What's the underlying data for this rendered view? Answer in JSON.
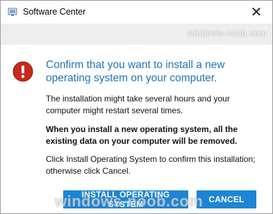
{
  "window": {
    "title": "Software Center",
    "close_glyph": "✕",
    "app_icon": "software-center-icon"
  },
  "watermark": {
    "top": "windows-noob.com",
    "bottom": "windows-noob.com"
  },
  "dialog": {
    "icon": "error-icon",
    "heading": "Confirm that you want to install a new operating system on your computer.",
    "paragraph1": "The installation might take several hours and your computer might restart several times.",
    "paragraph2": "When you install a new operating system, all the existing data on your computer will be removed.",
    "paragraph3": "Click Install Operating System to confirm this installation; otherwise click Cancel."
  },
  "buttons": {
    "install_label": "INSTALL OPERATING SYSTEM",
    "cancel_label": "CANCEL"
  },
  "colors": {
    "accent": "#1d85d4",
    "heading": "#1f74b8",
    "error": "#c42b1c"
  }
}
